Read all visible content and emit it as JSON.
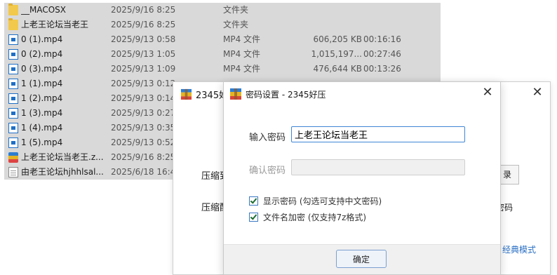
{
  "file_list": {
    "rows": [
      {
        "name": "__MACOSX",
        "date": "2025/9/16 8:25",
        "type": "文件夹",
        "size": "",
        "duration": "",
        "icon": "folder-icon",
        "selected": true
      },
      {
        "name": "上老王论坛当老王",
        "date": "2025/9/16 8:25",
        "type": "文件夹",
        "size": "",
        "duration": "",
        "icon": "folder-icon",
        "selected": true
      },
      {
        "name": "0 (1).mp4",
        "date": "2025/9/13 0:58",
        "type": "MP4 文件",
        "size": "606,205 KB",
        "duration": "00:16:16",
        "icon": "video-file-icon",
        "selected": true
      },
      {
        "name": "0 (2).mp4",
        "date": "2025/9/13 1:05",
        "type": "MP4 文件",
        "size": "1,015,197...",
        "duration": "00:27:46",
        "icon": "video-file-icon",
        "selected": true
      },
      {
        "name": "0 (3).mp4",
        "date": "2025/9/13 1:09",
        "type": "MP4 文件",
        "size": "476,644 KB",
        "duration": "00:13:26",
        "icon": "video-file-icon",
        "selected": true
      },
      {
        "name": "1 (1).mp4",
        "date": "2025/9/13 0:12",
        "type": "",
        "size": "",
        "duration": "",
        "icon": "video-file-icon",
        "selected": true
      },
      {
        "name": "1 (2).mp4",
        "date": "2025/9/13 0:14",
        "type": "",
        "size": "",
        "duration": "",
        "icon": "video-file-icon",
        "selected": true
      },
      {
        "name": "1 (3).mp4",
        "date": "2025/9/13 0:27",
        "type": "",
        "size": "",
        "duration": "",
        "icon": "video-file-icon",
        "selected": true
      },
      {
        "name": "1 (4).mp4",
        "date": "2025/9/13 0:35",
        "type": "",
        "size": "",
        "duration": "",
        "icon": "video-file-icon",
        "selected": true
      },
      {
        "name": "1 (5).mp4",
        "date": "2025/9/13 0:52",
        "type": "",
        "size": "",
        "duration": "",
        "icon": "video-file-icon",
        "selected": true
      },
      {
        "name": "上老王论坛当老王.z...",
        "date": "2025/9/16 8:25",
        "type": "",
        "size": "",
        "duration": "",
        "icon": "archive-file-icon",
        "selected": true
      },
      {
        "name": "由老王论坛hjhhlsal...",
        "date": "2025/6/18 16:4",
        "type": "",
        "size": "",
        "duration": "",
        "icon": "text-file-icon",
        "selected": true
      }
    ]
  },
  "back_dialog": {
    "title": "2345好",
    "label_1": "压缩到",
    "label_2": "压缩配",
    "button_label": "录",
    "right_text": "密码",
    "mode_link": "经典模式",
    "close": "✕"
  },
  "password_dialog": {
    "title": "密码设置 - 2345好压",
    "close": "✕",
    "password_label": "输入密码",
    "password_value": "上老王论坛当老王",
    "confirm_label": "确认密码",
    "confirm_value": "",
    "show_password_label": "显示密码 (勾选可支持中文密码)",
    "show_password_checked": true,
    "encrypt_names_label": "文件名加密 (仅支持7z格式)",
    "encrypt_names_checked": true,
    "ok_label": "确定"
  },
  "colors": {
    "selection": "#d9d9d9",
    "link": "#2a6fc4",
    "focus_border": "#3f86d6"
  }
}
